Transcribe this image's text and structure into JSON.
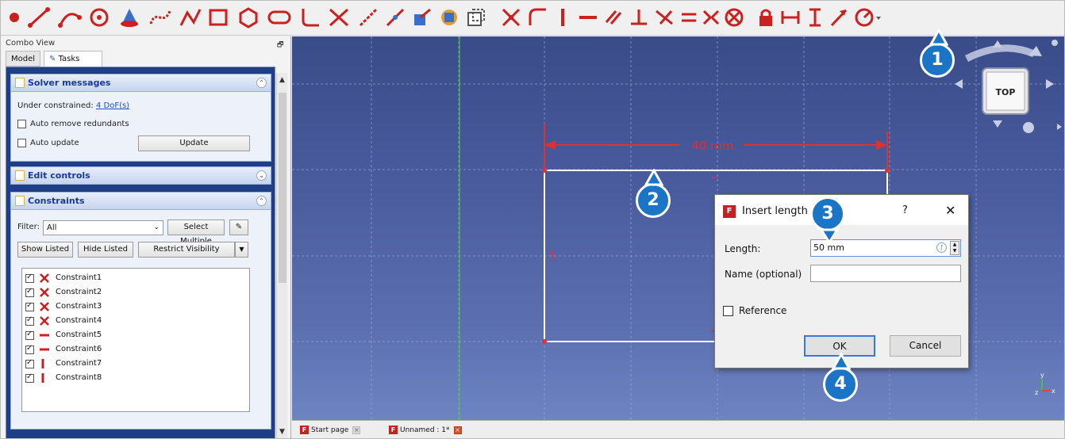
{
  "combo_view": {
    "title": "Combo View",
    "tabs": [
      {
        "label": "Model"
      },
      {
        "label": "Tasks"
      }
    ],
    "solver": {
      "title": "Solver messages",
      "under_constrained_label": "Under constrained:",
      "dof_link": "4 DoF(s)",
      "auto_remove_redundants": "Auto remove redundants",
      "auto_update": "Auto update",
      "update_button": "Update"
    },
    "edit_controls": {
      "title": "Edit controls"
    },
    "constraints": {
      "title": "Constraints",
      "filter_label": "Filter:",
      "filter_value": "All",
      "select_multiple": "Select Multiple",
      "show_listed": "Show Listed",
      "hide_listed": "Hide Listed",
      "restrict_visibility": "Restrict Visibility",
      "items": [
        {
          "name": "Constraint1",
          "type": "coincident"
        },
        {
          "name": "Constraint2",
          "type": "coincident"
        },
        {
          "name": "Constraint3",
          "type": "coincident"
        },
        {
          "name": "Constraint4",
          "type": "coincident"
        },
        {
          "name": "Constraint5",
          "type": "horizontal"
        },
        {
          "name": "Constraint6",
          "type": "horizontal"
        },
        {
          "name": "Constraint7",
          "type": "vertical"
        },
        {
          "name": "Constraint8",
          "type": "vertical"
        }
      ]
    }
  },
  "viewport": {
    "dimension_label": "40 mm",
    "navcube_face": "TOP"
  },
  "bottom_tabs": [
    {
      "label": "Start page"
    },
    {
      "label": "Unnamed : 1*"
    }
  ],
  "dialog": {
    "title": "Insert length",
    "help": "?",
    "close": "✕",
    "length_label": "Length:",
    "length_value": "50 mm",
    "name_label": "Name (optional)",
    "name_value": "",
    "reference_label": "Reference",
    "ok": "OK",
    "cancel": "Cancel"
  },
  "callouts": [
    "1",
    "2",
    "3",
    "4"
  ],
  "colors": {
    "sketch_red": "#e03030",
    "callout_blue": "#1a75c6",
    "icon_red": "#cc1f1f"
  }
}
